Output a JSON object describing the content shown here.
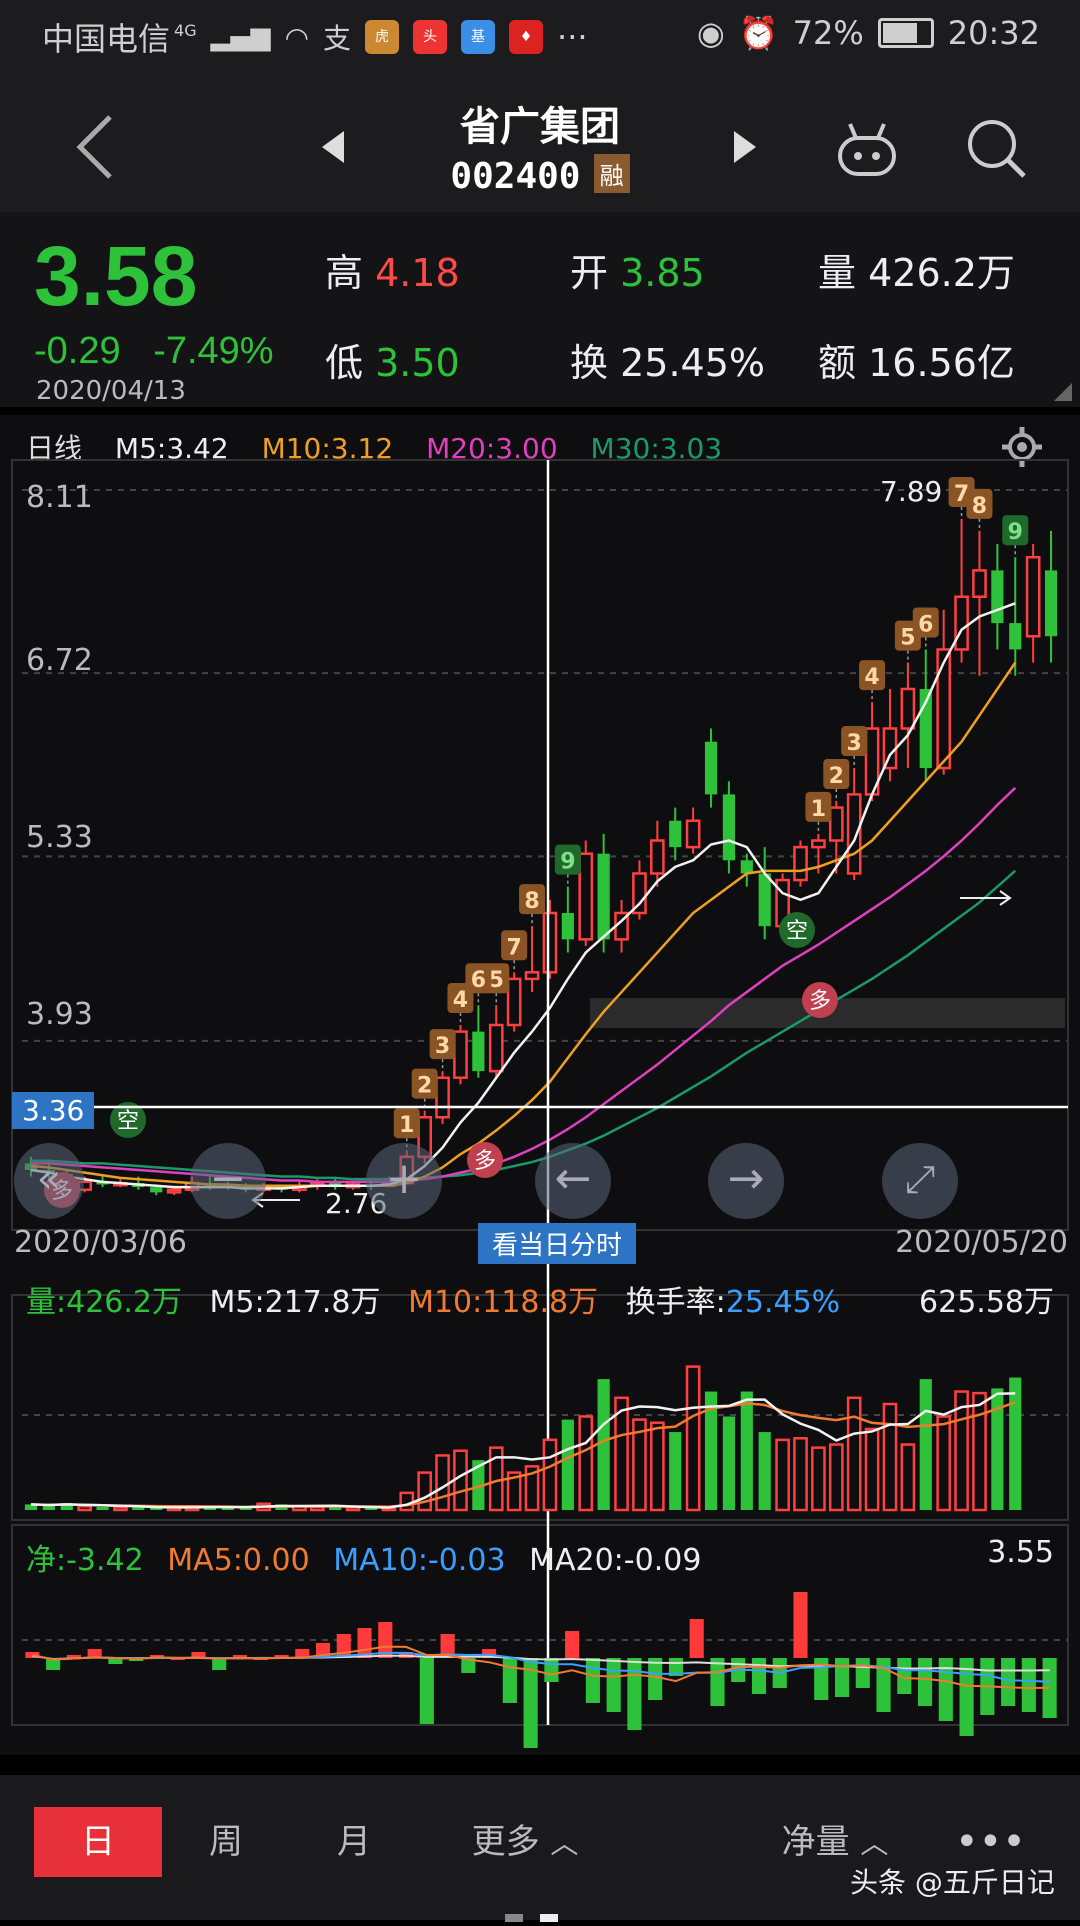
{
  "status_bar": {
    "carrier": "中国电信",
    "net": "4G",
    "battery": "72%",
    "time": "20:32"
  },
  "header": {
    "title": "省广集团",
    "code": "002400",
    "badge": "融"
  },
  "quote": {
    "price": "3.58",
    "change": "-0.29",
    "change_pct": "-7.49%",
    "date": "2020/04/13",
    "high_label": "高",
    "high": "4.18",
    "low_label": "低",
    "low": "3.50",
    "open_label": "开",
    "open": "3.85",
    "turnover_label": "换",
    "turnover": "25.45%",
    "volume_label": "量",
    "volume": "426.2万",
    "amount_label": "额",
    "amount": "16.56亿"
  },
  "kline": {
    "period": "日线",
    "m5": "M5:3.42",
    "m10": "M10:3.12",
    "m20": "M20:3.00",
    "m30": "M30:3.03",
    "y_labels": [
      "8.11",
      "6.72",
      "5.33",
      "3.93"
    ],
    "crosshair_price": "3.36",
    "max_label": "7.89",
    "min_label": "2.76",
    "start_date": "2020/03/06",
    "end_date": "2020/05/20",
    "minute_button": "看当日分时",
    "signal_kong": "空",
    "signal_duo": "多"
  },
  "volume": {
    "label": "量:426.2万",
    "m5": "M5:217.8万",
    "m10": "M10:118.8万",
    "turnover_label": "换手率:",
    "turnover": "25.45%",
    "max": "625.58万"
  },
  "netflow": {
    "label": "净:-3.42",
    "ma5": "MA5:0.00",
    "ma10": "MA10:-0.03",
    "ma20": "MA20:-0.09",
    "max": "3.55"
  },
  "bottom_nav": {
    "day": "日",
    "week": "周",
    "month": "月",
    "more": "更多",
    "indicator": "净量",
    "watermark": "头条 @五斤日记"
  },
  "chart_data": {
    "type": "candlestick",
    "ylim": [
      2.76,
      8.11
    ],
    "candles": [
      {
        "o": 3.0,
        "c": 2.95,
        "h": 3.05,
        "l": 2.9
      },
      {
        "o": 2.95,
        "c": 2.93,
        "h": 3.0,
        "l": 2.88
      },
      {
        "o": 2.92,
        "c": 2.8,
        "h": 2.95,
        "l": 2.78
      },
      {
        "o": 2.8,
        "c": 2.86,
        "h": 2.9,
        "l": 2.78
      },
      {
        "o": 2.86,
        "c": 2.84,
        "h": 2.9,
        "l": 2.82
      },
      {
        "o": 2.84,
        "c": 2.85,
        "h": 2.88,
        "l": 2.82
      },
      {
        "o": 2.85,
        "c": 2.82,
        "h": 2.9,
        "l": 2.8
      },
      {
        "o": 2.82,
        "c": 2.78,
        "h": 2.84,
        "l": 2.76
      },
      {
        "o": 2.78,
        "c": 2.8,
        "h": 2.82,
        "l": 2.76
      },
      {
        "o": 2.8,
        "c": 2.85,
        "h": 2.9,
        "l": 2.78
      },
      {
        "o": 2.85,
        "c": 2.83,
        "h": 2.9,
        "l": 2.8
      },
      {
        "o": 2.83,
        "c": 2.82,
        "h": 2.86,
        "l": 2.8
      },
      {
        "o": 2.82,
        "c": 2.8,
        "h": 2.85,
        "l": 2.78
      },
      {
        "o": 2.8,
        "c": 2.82,
        "h": 2.85,
        "l": 2.78
      },
      {
        "o": 2.82,
        "c": 2.8,
        "h": 2.84,
        "l": 2.78
      },
      {
        "o": 2.8,
        "c": 2.83,
        "h": 2.86,
        "l": 2.78
      },
      {
        "o": 2.83,
        "c": 2.85,
        "h": 2.88,
        "l": 2.8
      },
      {
        "o": 2.85,
        "c": 2.82,
        "h": 2.88,
        "l": 2.8
      },
      {
        "o": 2.82,
        "c": 2.84,
        "h": 2.86,
        "l": 2.8
      },
      {
        "o": 2.84,
        "c": 2.83,
        "h": 2.88,
        "l": 2.8
      },
      {
        "o": 2.83,
        "c": 2.85,
        "h": 2.9,
        "l": 2.82
      },
      {
        "o": 2.85,
        "c": 3.05,
        "h": 3.1,
        "l": 2.84
      },
      {
        "o": 3.05,
        "c": 3.35,
        "h": 3.4,
        "l": 3.0
      },
      {
        "o": 3.35,
        "c": 3.65,
        "h": 3.7,
        "l": 3.3
      },
      {
        "o": 3.65,
        "c": 4.0,
        "h": 4.05,
        "l": 3.6
      },
      {
        "o": 4.0,
        "c": 3.7,
        "h": 4.2,
        "l": 3.65
      },
      {
        "o": 3.7,
        "c": 4.05,
        "h": 4.2,
        "l": 3.65
      },
      {
        "o": 4.05,
        "c": 4.4,
        "h": 4.45,
        "l": 4.0
      },
      {
        "o": 4.4,
        "c": 4.45,
        "h": 4.8,
        "l": 4.3
      },
      {
        "o": 4.45,
        "c": 4.9,
        "h": 5.0,
        "l": 4.4
      },
      {
        "o": 4.9,
        "c": 4.7,
        "h": 5.1,
        "l": 4.6
      },
      {
        "o": 4.7,
        "c": 5.35,
        "h": 5.45,
        "l": 4.65
      },
      {
        "o": 5.35,
        "c": 4.7,
        "h": 5.5,
        "l": 4.6
      },
      {
        "o": 4.7,
        "c": 4.9,
        "h": 5.0,
        "l": 4.6
      },
      {
        "o": 4.9,
        "c": 5.2,
        "h": 5.3,
        "l": 4.85
      },
      {
        "o": 5.2,
        "c": 5.45,
        "h": 5.6,
        "l": 5.1
      },
      {
        "o": 5.6,
        "c": 5.4,
        "h": 5.7,
        "l": 5.3
      },
      {
        "o": 5.4,
        "c": 5.6,
        "h": 5.7,
        "l": 5.35
      },
      {
        "o": 6.2,
        "c": 5.8,
        "h": 6.3,
        "l": 5.7
      },
      {
        "o": 5.8,
        "c": 5.3,
        "h": 5.9,
        "l": 5.2
      },
      {
        "o": 5.3,
        "c": 5.2,
        "h": 5.35,
        "l": 5.1
      },
      {
        "o": 5.2,
        "c": 4.8,
        "h": 5.4,
        "l": 4.7
      },
      {
        "o": 4.8,
        "c": 5.15,
        "h": 5.2,
        "l": 4.75
      },
      {
        "o": 5.15,
        "c": 5.4,
        "h": 5.45,
        "l": 5.1
      },
      {
        "o": 5.4,
        "c": 5.45,
        "h": 5.5,
        "l": 5.2
      },
      {
        "o": 5.45,
        "c": 5.7,
        "h": 5.75,
        "l": 5.2
      },
      {
        "o": 5.2,
        "c": 5.8,
        "h": 6.0,
        "l": 5.15
      },
      {
        "o": 5.8,
        "c": 6.3,
        "h": 6.5,
        "l": 5.75
      },
      {
        "o": 6.0,
        "c": 6.3,
        "h": 6.6,
        "l": 5.9
      },
      {
        "o": 6.3,
        "c": 6.6,
        "h": 6.8,
        "l": 6.0
      },
      {
        "o": 6.6,
        "c": 6.0,
        "h": 6.9,
        "l": 5.9
      },
      {
        "o": 6.0,
        "c": 6.9,
        "h": 7.2,
        "l": 5.95
      },
      {
        "o": 6.9,
        "c": 7.3,
        "h": 7.89,
        "l": 6.8
      },
      {
        "o": 7.3,
        "c": 7.5,
        "h": 7.8,
        "l": 6.7
      },
      {
        "o": 7.5,
        "c": 7.1,
        "h": 7.7,
        "l": 6.9
      },
      {
        "o": 7.1,
        "c": 6.9,
        "h": 7.6,
        "l": 6.7
      },
      {
        "o": 7.0,
        "c": 7.6,
        "h": 7.7,
        "l": 6.8
      },
      {
        "o": 7.5,
        "c": 7.0,
        "h": 7.8,
        "l": 6.8
      }
    ],
    "ma5": [
      2.95,
      2.93,
      2.9,
      2.88,
      2.86,
      2.85,
      2.84,
      2.83,
      2.82,
      2.82,
      2.82,
      2.82,
      2.81,
      2.81,
      2.81,
      2.82,
      2.83,
      2.83,
      2.83,
      2.83,
      2.84,
      2.88,
      2.98,
      3.12,
      3.31,
      3.46,
      3.65,
      3.84,
      4.0,
      4.18,
      4.4,
      4.6,
      4.72,
      4.84,
      4.97,
      5.14,
      5.25,
      5.3,
      5.42,
      5.45,
      5.4,
      5.2,
      5.05,
      5.0,
      5.05,
      5.25,
      5.45,
      5.8,
      6.1,
      6.25,
      6.5,
      6.8,
      7.05,
      7.15,
      7.2,
      7.25
    ],
    "ma10": [
      2.98,
      2.97,
      2.95,
      2.93,
      2.91,
      2.89,
      2.88,
      2.87,
      2.86,
      2.85,
      2.84,
      2.84,
      2.83,
      2.83,
      2.83,
      2.83,
      2.83,
      2.83,
      2.83,
      2.83,
      2.83,
      2.85,
      2.9,
      2.97,
      3.07,
      3.15,
      3.25,
      3.36,
      3.48,
      3.62,
      3.8,
      3.98,
      4.15,
      4.3,
      4.45,
      4.6,
      4.75,
      4.9,
      5.0,
      5.1,
      5.2,
      5.22,
      5.22,
      5.22,
      5.25,
      5.3,
      5.35,
      5.45,
      5.6,
      5.75,
      5.9,
      6.05,
      6.2,
      6.4,
      6.6,
      6.8
    ],
    "ma20": [
      3.0,
      3.0,
      2.99,
      2.98,
      2.97,
      2.96,
      2.95,
      2.94,
      2.93,
      2.92,
      2.91,
      2.9,
      2.89,
      2.88,
      2.87,
      2.87,
      2.86,
      2.86,
      2.86,
      2.86,
      2.86,
      2.87,
      2.88,
      2.9,
      2.93,
      2.96,
      3.0,
      3.05,
      3.11,
      3.18,
      3.26,
      3.35,
      3.45,
      3.55,
      3.65,
      3.75,
      3.86,
      3.97,
      4.08,
      4.2,
      4.3,
      4.4,
      4.5,
      4.58,
      4.66,
      4.75,
      4.84,
      4.93,
      5.02,
      5.12,
      5.22,
      5.33,
      5.45,
      5.58,
      5.72,
      5.85
    ],
    "ma30": [
      3.02,
      3.02,
      3.01,
      3.0,
      3.0,
      2.99,
      2.98,
      2.97,
      2.96,
      2.95,
      2.94,
      2.93,
      2.92,
      2.91,
      2.9,
      2.9,
      2.89,
      2.89,
      2.88,
      2.88,
      2.88,
      2.88,
      2.89,
      2.9,
      2.91,
      2.93,
      2.95,
      2.98,
      3.01,
      3.05,
      3.1,
      3.15,
      3.21,
      3.28,
      3.35,
      3.42,
      3.5,
      3.58,
      3.66,
      3.75,
      3.84,
      3.92,
      4.0,
      4.08,
      4.16,
      4.24,
      4.32,
      4.4,
      4.49,
      4.58,
      4.68,
      4.78,
      4.88,
      4.98,
      5.1,
      5.22
    ],
    "signals": [
      {
        "i": 21,
        "t": "1"
      },
      {
        "i": 22,
        "t": "2"
      },
      {
        "i": 23,
        "t": "3"
      },
      {
        "i": 24,
        "t": "4"
      },
      {
        "i": 26,
        "t": "5"
      },
      {
        "i": 25,
        "t": "6"
      },
      {
        "i": 27,
        "t": "7"
      },
      {
        "i": 28,
        "t": "8"
      },
      {
        "i": 30,
        "t": "9"
      },
      {
        "i": 44,
        "t": "1"
      },
      {
        "i": 45,
        "t": "2"
      },
      {
        "i": 46,
        "t": "3"
      },
      {
        "i": 47,
        "t": "4"
      },
      {
        "i": 49,
        "t": "5"
      },
      {
        "i": 50,
        "t": "6"
      },
      {
        "i": 52,
        "t": "7"
      },
      {
        "i": 53,
        "t": "8"
      },
      {
        "i": 55,
        "t": "9"
      }
    ],
    "volume": [
      18,
      14,
      22,
      12,
      10,
      9,
      8,
      7,
      9,
      10,
      12,
      8,
      7,
      20,
      18,
      12,
      10,
      8,
      9,
      7,
      6,
      55,
      120,
      175,
      190,
      160,
      200,
      120,
      140,
      225,
      290,
      300,
      420,
      360,
      290,
      280,
      250,
      460,
      380,
      300,
      380,
      250,
      225,
      230,
      200,
      210,
      360,
      260,
      340,
      210,
      420,
      300,
      380,
      375,
      390,
      425
    ],
    "netflow": [
      0.2,
      -0.4,
      0.1,
      0.3,
      -0.2,
      -0.1,
      0.1,
      0.0,
      0.2,
      -0.4,
      0.1,
      0.0,
      0.1,
      0.3,
      0.5,
      0.8,
      1.0,
      1.2,
      0.2,
      -2.2,
      0.8,
      -0.5,
      0.3,
      -1.5,
      -3.0,
      -0.8,
      0.9,
      -1.5,
      -1.8,
      -2.4,
      -1.4,
      -0.6,
      1.3,
      -1.6,
      -0.8,
      -1.2,
      -1.0,
      2.2,
      -1.4,
      -1.3,
      -1.0,
      -1.8,
      -1.2,
      -1.6,
      -2.1,
      -2.6,
      -1.9,
      -1.6,
      -1.8,
      -2.0
    ]
  }
}
